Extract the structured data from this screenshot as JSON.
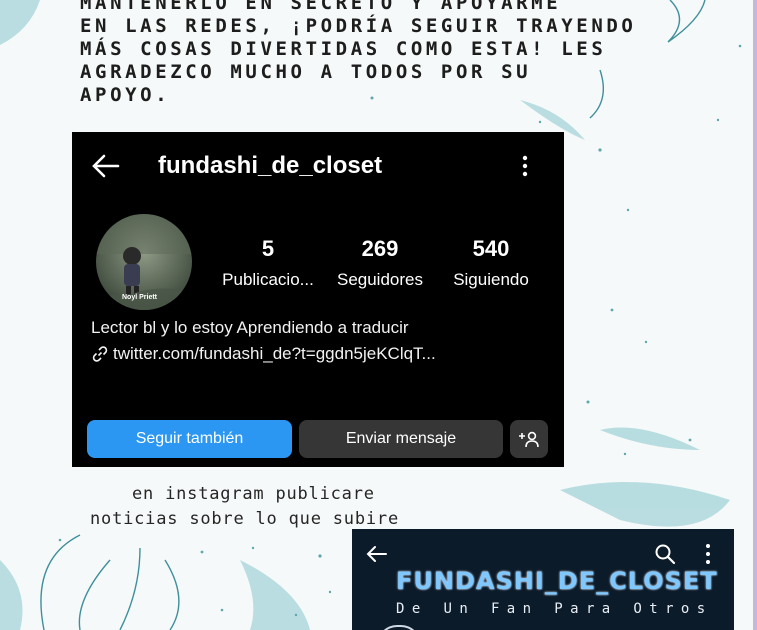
{
  "intro_text": {
    "lines": [
      "MANTENERLO EN SECRETO Y APOYARME",
      "EN LAS REDES, ¡PODRÍA SEGUIR TRAYENDO",
      "MÁS COSAS DIVERTIDAS COMO ESTA! LES",
      "AGRADEZCO MUCHO A TODOS POR SU",
      "APOYO."
    ]
  },
  "instagram": {
    "username": "fundashi_de_closet",
    "avatar_caption": "Noyl Priett",
    "stats": [
      {
        "value": "5",
        "label": "Publicacio..."
      },
      {
        "value": "269",
        "label": "Seguidores"
      },
      {
        "value": "540",
        "label": "Siguiendo"
      }
    ],
    "bio": "Lector bl y lo estoy Aprendiendo a traducir",
    "link": "twitter.com/fundashi_de?t=ggdn5jeKClqT...",
    "buttons": {
      "follow": "Seguir también",
      "message": "Enviar mensaje",
      "add_user": "+8"
    },
    "colors": {
      "background": "#000000",
      "follow": "#2c97f2",
      "secondary": "#363636"
    }
  },
  "middle_text": {
    "line1": "en instagram publicare",
    "line2": "noticias sobre lo que subire"
  },
  "second_card": {
    "title": "FUNDASHI_DE_CLOSET",
    "subtitle": "De Un Fan Para Otros",
    "colors": {
      "background": "#0b1b2a",
      "title": "#7ec8ff"
    }
  }
}
